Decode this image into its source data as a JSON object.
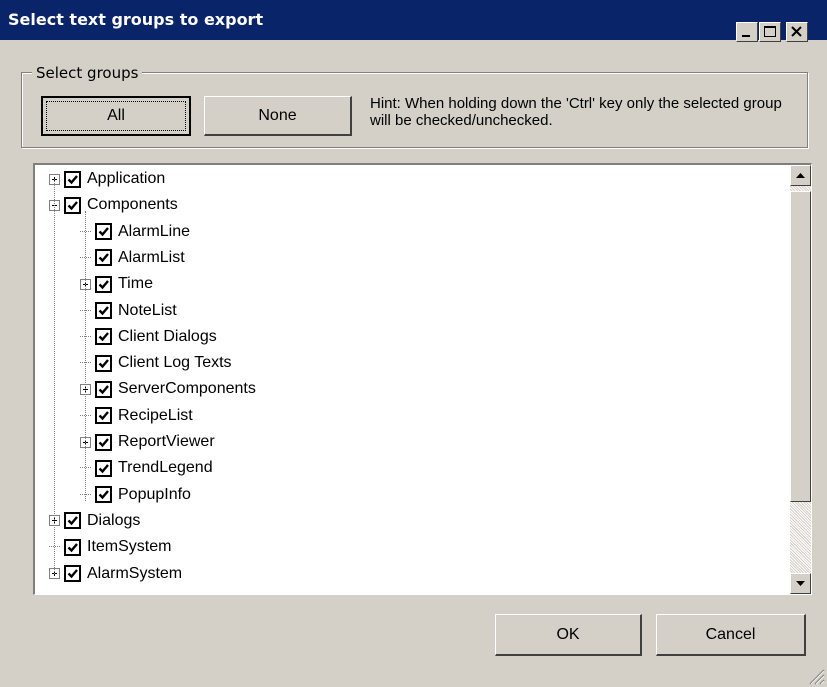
{
  "window": {
    "title": "Select text groups to export"
  },
  "select_groups": {
    "legend": "Select groups",
    "all_label": "All",
    "none_label": "None",
    "hint": "Hint: When holding down the 'Ctrl' key only the selected group will be checked/unchecked."
  },
  "tree": {
    "items": [
      {
        "label": "Application",
        "level": 0,
        "expander": "plus",
        "checked": true
      },
      {
        "label": "Components",
        "level": 0,
        "expander": "minus",
        "checked": true
      },
      {
        "label": "AlarmLine",
        "level": 1,
        "expander": "none",
        "checked": true
      },
      {
        "label": "AlarmList",
        "level": 1,
        "expander": "none",
        "checked": true
      },
      {
        "label": "Time",
        "level": 1,
        "expander": "plus",
        "checked": true
      },
      {
        "label": "NoteList",
        "level": 1,
        "expander": "none",
        "checked": true
      },
      {
        "label": "Client Dialogs",
        "level": 1,
        "expander": "none",
        "checked": true
      },
      {
        "label": "Client Log Texts",
        "level": 1,
        "expander": "none",
        "checked": true
      },
      {
        "label": "ServerComponents",
        "level": 1,
        "expander": "plus",
        "checked": true
      },
      {
        "label": "RecipeList",
        "level": 1,
        "expander": "none",
        "checked": true
      },
      {
        "label": "ReportViewer",
        "level": 1,
        "expander": "plus",
        "checked": true
      },
      {
        "label": "TrendLegend",
        "level": 1,
        "expander": "none",
        "checked": true
      },
      {
        "label": "PopupInfo",
        "level": 1,
        "expander": "none",
        "checked": true
      },
      {
        "label": "Dialogs",
        "level": 0,
        "expander": "plus",
        "checked": true
      },
      {
        "label": "ItemSystem",
        "level": 0,
        "expander": "none",
        "checked": true
      },
      {
        "label": "AlarmSystem",
        "level": 0,
        "expander": "plus",
        "checked": true
      }
    ]
  },
  "buttons": {
    "ok_label": "OK",
    "cancel_label": "Cancel"
  }
}
